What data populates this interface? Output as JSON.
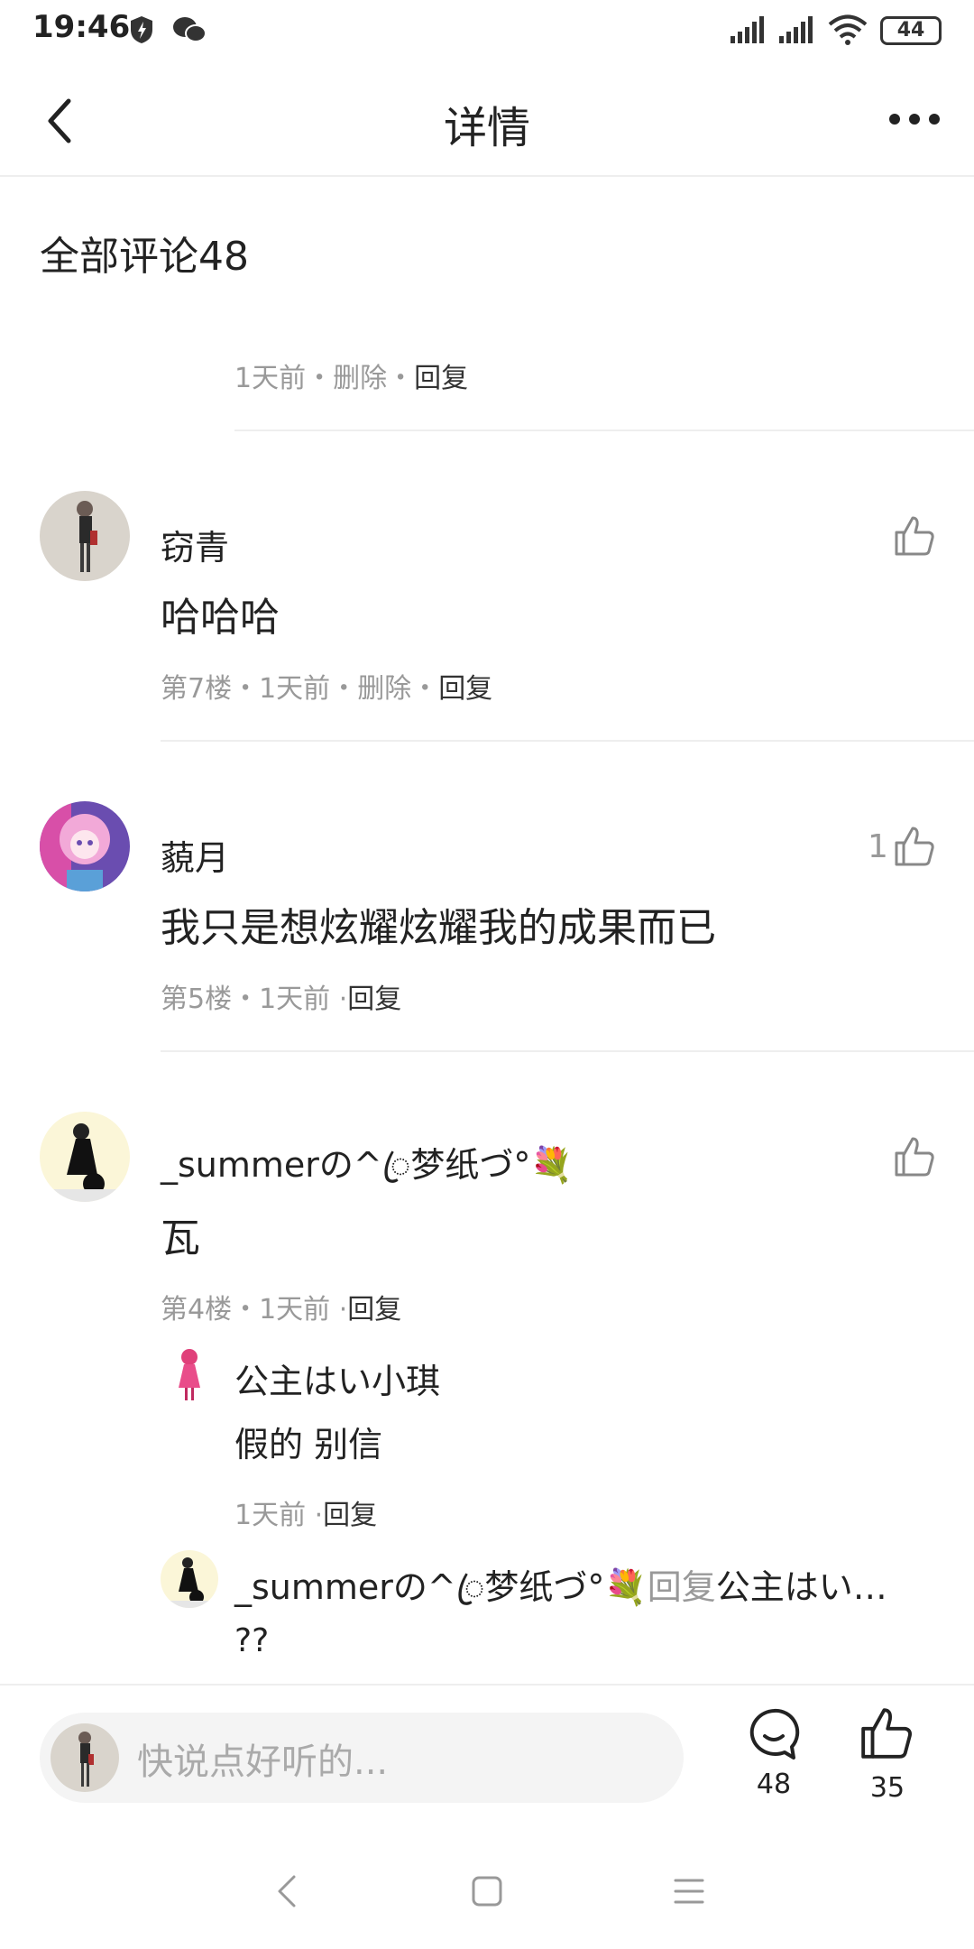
{
  "status": {
    "time": "19:46",
    "battery": "44"
  },
  "header": {
    "title": "详情"
  },
  "comments_section": {
    "title": "全部评论48",
    "top_partial": {
      "time": "1天前",
      "delete": "删除",
      "reply": "回复",
      "sep": "・"
    }
  },
  "comments": [
    {
      "name": "窃青",
      "content": "哈哈哈",
      "floor": "第7楼",
      "time": "1天前",
      "delete": "删除",
      "reply": "回复",
      "likes": ""
    },
    {
      "name": "藐月",
      "content": "我只是想炫耀炫耀我的成果而已",
      "floor": "第5楼",
      "time": "1天前",
      "reply": "回复",
      "likes": "1"
    },
    {
      "name": "_summerの^ꦿ梦纸づ°💐",
      "content": "瓦",
      "floor": "第4楼",
      "time": "1天前",
      "reply": "回复",
      "likes": "",
      "replies": [
        {
          "name": "公主はい小琪",
          "content": "假的 别信",
          "time": "1天前",
          "reply": "回复"
        },
        {
          "name": "_summerの^ꦿ梦纸づ°💐",
          "reply_word": "回复",
          "target": "公主はい…",
          "content": "??"
        }
      ]
    }
  ],
  "bottom": {
    "placeholder": "快说点好听的...",
    "comment_count": "48",
    "like_count": "35"
  },
  "icons": {
    "back": "back-arrow-icon",
    "more": "more-dots-icon",
    "like": "thumbs-up-icon",
    "comment": "comment-bubble-icon",
    "sys_back": "system-back-icon",
    "sys_home": "system-home-icon",
    "sys_menu": "system-menu-icon"
  }
}
